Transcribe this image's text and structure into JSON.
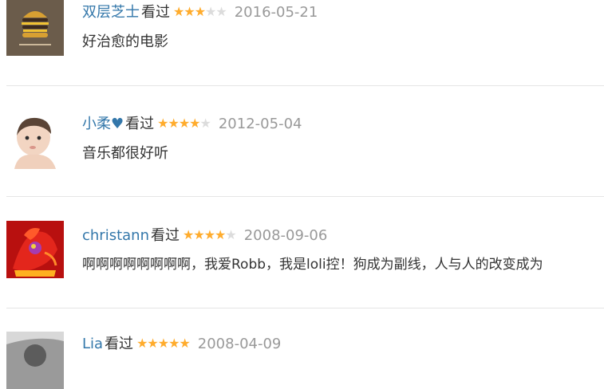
{
  "watched_label": "看过",
  "star_glyph": "★",
  "colors": {
    "username": "#3377aa",
    "star_filled": "#ffac2d",
    "star_empty": "#dcdcdc",
    "date": "#999999",
    "divider": "#e5e5e5"
  },
  "reviews": [
    {
      "username": "双层芝士",
      "rating": 3,
      "max_rating": 5,
      "date": "2016-05-21",
      "comment": "好治愈的电影",
      "avatar_icon": "double-cheeseburger-avatar"
    },
    {
      "username": "小柔♥",
      "rating": 4,
      "max_rating": 5,
      "date": "2012-05-04",
      "comment": "音乐都很好听",
      "avatar_icon": "baby-photo-avatar"
    },
    {
      "username": "christann",
      "rating": 4,
      "max_rating": 5,
      "date": "2008-09-06",
      "comment": "啊啊啊啊啊啊啊啊，我爱Robb，我是loli控！狗成为副线，人与人的改变成为",
      "avatar_icon": "red-dragon-avatar"
    },
    {
      "username": "Lia",
      "rating": 5,
      "max_rating": 5,
      "date": "2008-04-09",
      "comment": "",
      "avatar_icon": "grayscale-photo-avatar"
    }
  ]
}
